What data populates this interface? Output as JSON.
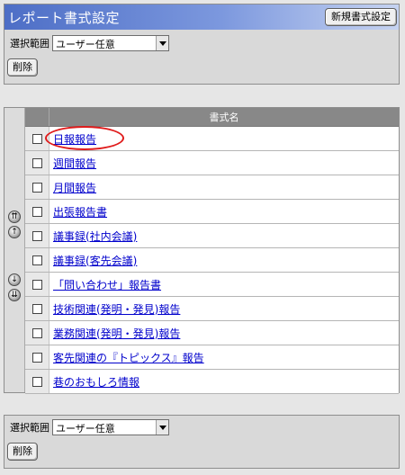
{
  "header": {
    "title": "レポート書式設定",
    "new_format_button": "新規書式設定"
  },
  "top_controls": {
    "scope_label": "選択範囲",
    "scope_value": "ユーザー任意",
    "delete_button": "削除"
  },
  "list": {
    "column_header": "書式名",
    "items": [
      {
        "label": "日報報告",
        "checked": false,
        "highlighted": true
      },
      {
        "label": "週間報告",
        "checked": false
      },
      {
        "label": "月間報告",
        "checked": false
      },
      {
        "label": "出張報告書",
        "checked": false
      },
      {
        "label": "議事録(社内会議)",
        "checked": false
      },
      {
        "label": "議事録(客先会議)",
        "checked": false
      },
      {
        "label": "「問い合わせ」報告書",
        "checked": false
      },
      {
        "label": "技術関連(発明・発見)報告",
        "checked": false
      },
      {
        "label": "業務関連(発明・発見)報告",
        "checked": false
      },
      {
        "label": "客先関連の『トピックス』報告",
        "checked": false
      },
      {
        "label": "巷のおもしろ情報",
        "checked": false
      }
    ],
    "sort_icons": [
      "move-top-icon",
      "move-up-icon",
      "move-down-icon",
      "move-bottom-icon"
    ],
    "highlight_color": "#e01b1b"
  },
  "bottom_controls": {
    "scope_label": "選択範囲",
    "scope_value": "ユーザー任意",
    "delete_button": "削除"
  }
}
